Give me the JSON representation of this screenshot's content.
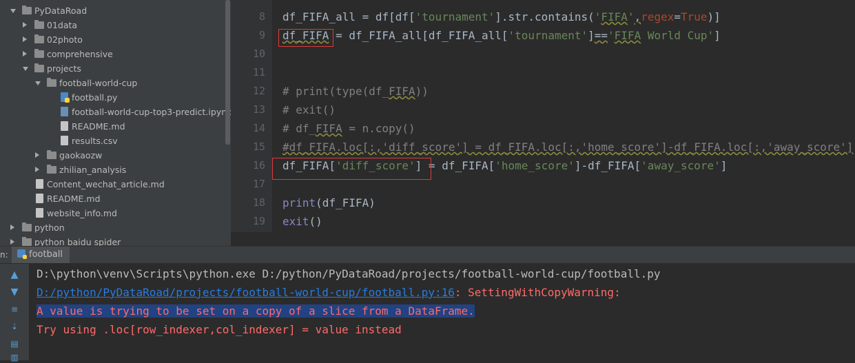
{
  "project_tree": {
    "items": [
      {
        "label": "PyDataRoad",
        "kind": "folder",
        "state": "open",
        "depth": 0
      },
      {
        "label": "01data",
        "kind": "folder",
        "state": "closed",
        "depth": 1
      },
      {
        "label": "02photo",
        "kind": "folder",
        "state": "closed",
        "depth": 1
      },
      {
        "label": "comprehensive",
        "kind": "folder",
        "state": "closed",
        "depth": 1
      },
      {
        "label": "projects",
        "kind": "folder",
        "state": "open",
        "depth": 1
      },
      {
        "label": "football-world-cup",
        "kind": "folder",
        "state": "open",
        "depth": 2
      },
      {
        "label": "football.py",
        "kind": "file-py",
        "depth": 3
      },
      {
        "label": "football-world-cup-top3-predict.ipynb",
        "kind": "file-ipynb",
        "depth": 3
      },
      {
        "label": "README.md",
        "kind": "file-md",
        "depth": 3
      },
      {
        "label": "results.csv",
        "kind": "file-csv",
        "depth": 3
      },
      {
        "label": "gaokaozw",
        "kind": "folder",
        "state": "closed",
        "depth": 2
      },
      {
        "label": "zhilian_analysis",
        "kind": "folder",
        "state": "closed",
        "depth": 2
      },
      {
        "label": "Content_wechat_article.md",
        "kind": "file-md",
        "depth": 1
      },
      {
        "label": "README.md",
        "kind": "file-md",
        "depth": 1
      },
      {
        "label": "website_info.md",
        "kind": "file-md",
        "depth": 1
      },
      {
        "label": "python",
        "kind": "folder",
        "state": "closed",
        "depth": 0
      },
      {
        "label": "python baidu spider",
        "kind": "folder",
        "state": "closed",
        "depth": 0
      }
    ]
  },
  "editor": {
    "line_numbers": [
      "8",
      "9",
      "10",
      "11",
      "12",
      "13",
      "14",
      "15",
      "16",
      "17",
      "18",
      "19"
    ],
    "lines": {
      "l8": {
        "a": "df_FIFA_all = df[df[",
        "b": "'tournament'",
        "c": "].str.contains(",
        "d": "'",
        "e": "FIFA",
        "f": "'",
        "g": ",",
        "h": "regex",
        "i": "=",
        "j": "True",
        "k": ")]"
      },
      "l9": {
        "a": "df_FIFA",
        "b": " = df_FIFA_all[df_FIFA_all[",
        "c": "'tournament'",
        "d": "]",
        "e": "==",
        "f": "'",
        "g": "FIFA",
        "h": " World Cup'",
        "i": "]"
      },
      "l12": {
        "a": "# print(type(df_",
        "b": "FIFA",
        "c": "))"
      },
      "l13": {
        "a": "# exit()"
      },
      "l14": {
        "a": "# df_",
        "b": "FIFA",
        "c": " = n.copy()"
      },
      "l15": {
        "a": "#df_FIFA.loc[:,'diff_score'] = df_FIFA.loc[:,'home_score']-df_FIFA.loc[:,'away_score']"
      },
      "l16": {
        "a": "df_FIFA[",
        "b": "'diff_score'",
        "c": "] = df_FIFA[",
        "d": "'home_score'",
        "e": "]-df_FIFA[",
        "f": "'away_score'",
        "g": "]"
      },
      "l18": {
        "a": "print",
        "b": "(df_FIFA)"
      },
      "l19": {
        "a": "exit",
        "b": "()"
      }
    }
  },
  "run_panel": {
    "prefix": "n:",
    "tab_label": "football",
    "output": {
      "command": "D:\\python\\venv\\Scripts\\python.exe D:/python/PyDataRoad/projects/football-world-cup/football.py",
      "warn_link": "D:/python/PyDataRoad/projects/football-world-cup/football.py:16",
      "warn_text": ": SettingWithCopyWarning:",
      "warn_line2": "A value is trying to be set on a copy of a slice from a DataFrame.",
      "warn_line3": "Try using .loc[row_indexer,col_indexer] = value instead"
    },
    "tools": [
      "arrow-up-icon",
      "arrow-down-icon",
      "soft-wrap-icon",
      "scroll-to-end-icon",
      "print-icon",
      "trash-icon"
    ]
  },
  "colors": {
    "editor_bg": "#2b2b2b",
    "sidebar_bg": "#3c3f41",
    "string": "#6a8759",
    "keyword": "#aa4926",
    "comment": "#808080",
    "error_text": "#ff6b68",
    "link": "#287bde",
    "highlight_box": "#e03a3a"
  }
}
